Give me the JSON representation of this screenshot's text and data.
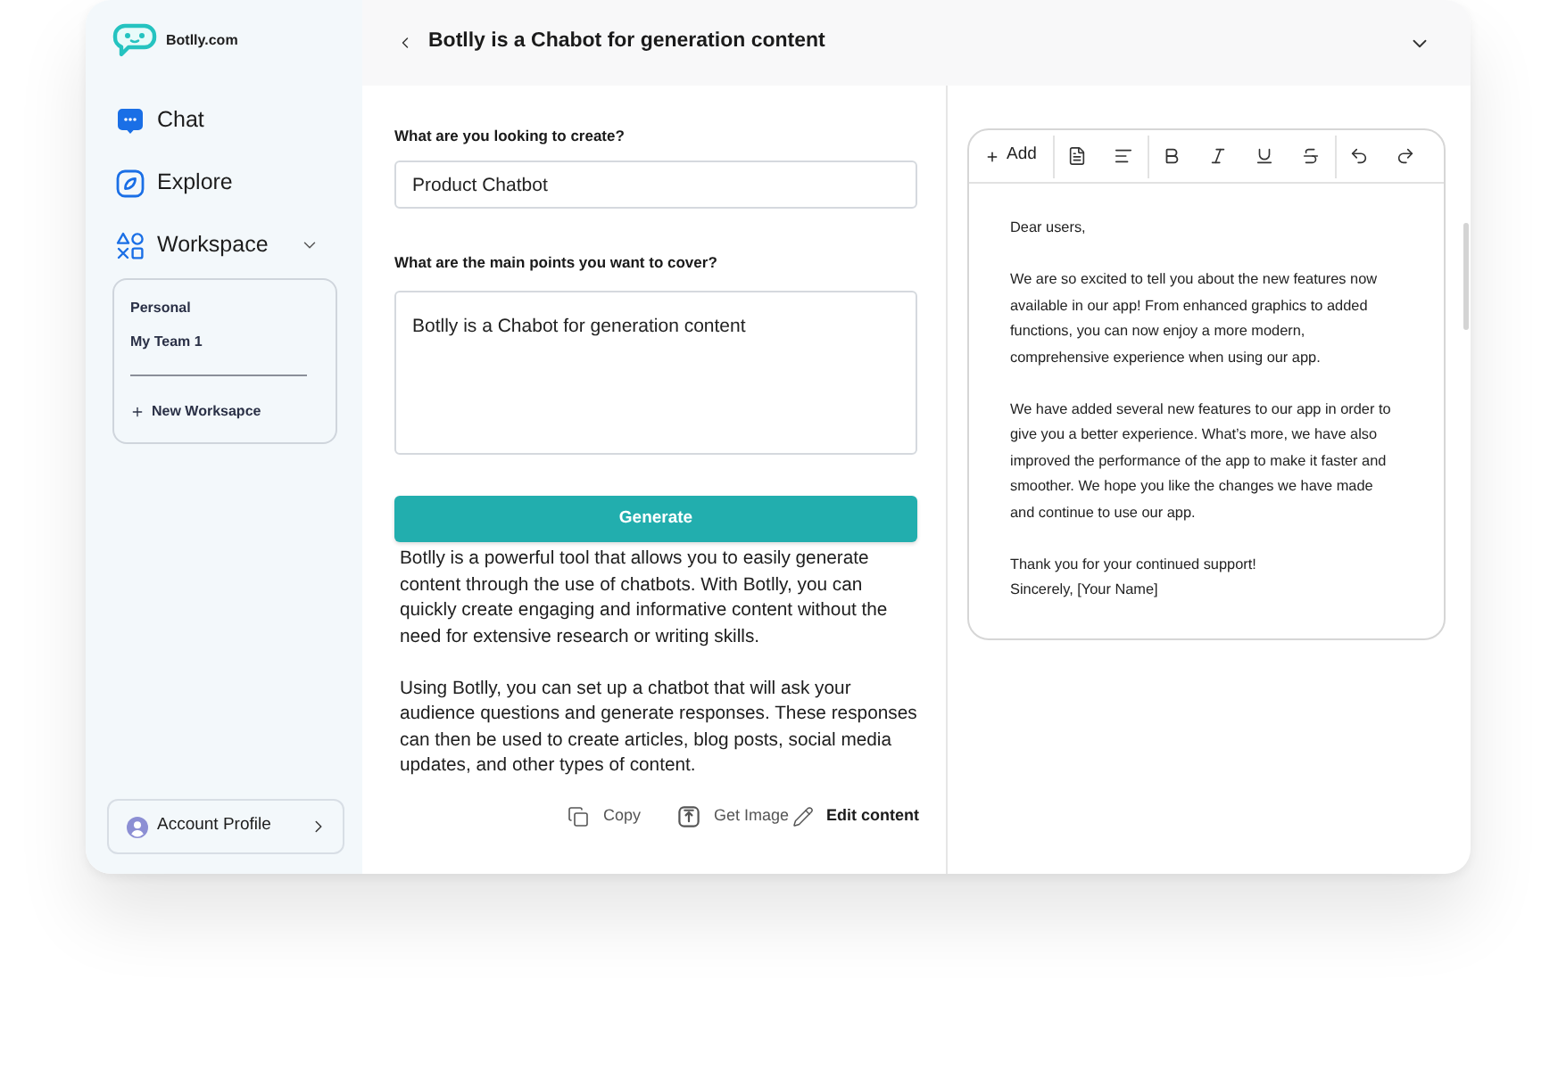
{
  "sidebar": {
    "logo": {
      "text": "Botlly.com"
    },
    "nav": [
      {
        "kind": "chat",
        "label": "Chat"
      },
      {
        "kind": "explore",
        "label": "Explore"
      }
    ],
    "workspace": {
      "label": "Workspace",
      "expanded": true,
      "items": [
        "Personal",
        "My Team 1"
      ],
      "new_label": "New Worksapce"
    },
    "account": {
      "label": "Account Profile"
    }
  },
  "header": {
    "title": "Botlly is a Chabot for generation content"
  },
  "form": {
    "fields": [
      {
        "kind": "input",
        "label": "What are you looking to create?",
        "value": "Product Chatbot"
      },
      {
        "kind": "textarea",
        "label": "What are the main points you want to cover?",
        "value": "Botlly is a Chabot for generation content"
      }
    ],
    "generate_button": "Generate"
  },
  "result": {
    "paragraphs": [
      "Botlly is a powerful tool that allows you to easily generate content through the use of chatbots. With Botlly, you can quickly create engaging and informative content without the need for extensive research or writing skills.",
      "Using Botlly, you can set up a chatbot that will ask your audience questions and generate responses. These responses can then be used to create articles, blog posts, social media updates, and other types of content."
    ],
    "actions": [
      {
        "kind": "copy",
        "label": "Copy",
        "primary": false
      },
      {
        "kind": "image",
        "label": "Get Image",
        "primary": false
      },
      {
        "kind": "edit",
        "label": "Edit content",
        "primary": true
      }
    ]
  },
  "editor": {
    "toolbar": [
      [
        {
          "kind": "add",
          "label": "Add"
        }
      ],
      [
        {
          "kind": "document"
        },
        {
          "kind": "align"
        }
      ],
      [
        {
          "kind": "bold"
        },
        {
          "kind": "italic"
        },
        {
          "kind": "underline"
        },
        {
          "kind": "strikethrough"
        }
      ],
      [
        {
          "kind": "undo"
        },
        {
          "kind": "redo"
        }
      ]
    ],
    "blocks": [
      [
        "Dear users,"
      ],
      [
        "We are so excited to tell you about the new features now available in our app! From enhanced graphics to added functions, you can now enjoy a more modern, comprehensive experience when using our app."
      ],
      [
        "We have added several new features to our app in order to give you a better experience. What’s more, we have also improved the performance of the app to make it faster and smoother. We hope you like the changes we have made and continue to use our app."
      ],
      [
        "Thank you for your continued support!",
        "Sincerely, [Your Name]"
      ]
    ]
  }
}
